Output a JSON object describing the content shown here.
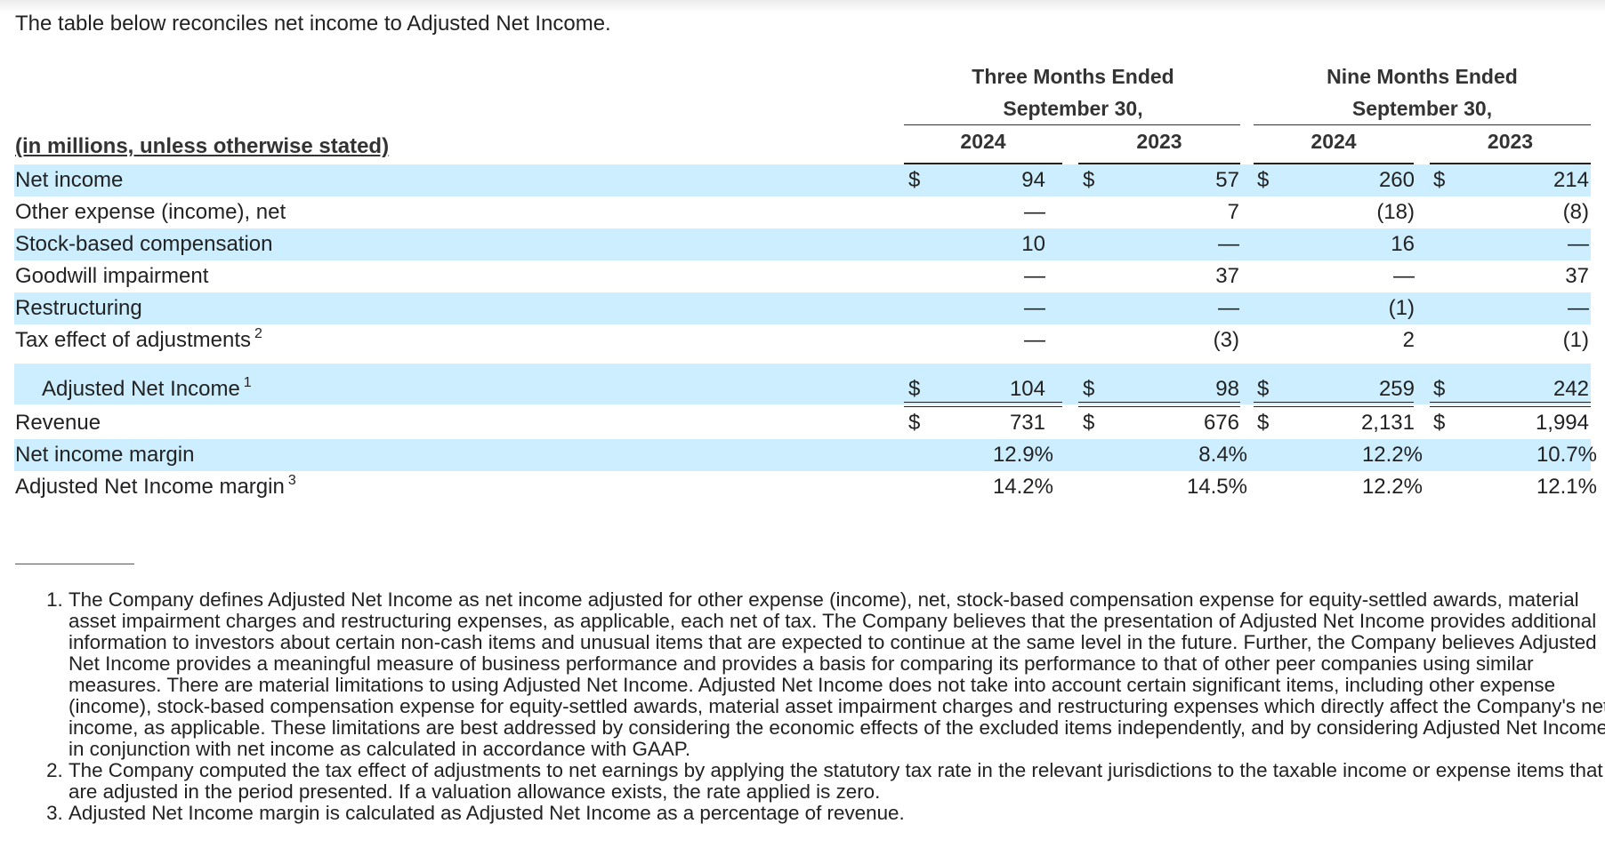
{
  "intro": "The table below reconciles net income to Adjusted Net Income.",
  "header": {
    "units_label": "(in millions, unless otherwise stated)",
    "groups": [
      {
        "line1": "Three Months Ended",
        "line2": "September 30,",
        "years": [
          "2024",
          "2023"
        ]
      },
      {
        "line1": "Nine Months Ended",
        "line2": "September 30,",
        "years": [
          "2024",
          "2023"
        ]
      }
    ]
  },
  "currency_symbol": "$",
  "rows": [
    {
      "label": "Net income",
      "sup": "",
      "values": [
        "94",
        "57",
        "260",
        "214"
      ]
    },
    {
      "label": "Other expense (income), net",
      "sup": "",
      "values": [
        "—",
        "7",
        "(18)",
        "(8)"
      ]
    },
    {
      "label": "Stock-based compensation",
      "sup": "",
      "values": [
        "10",
        "—",
        "16",
        "—"
      ]
    },
    {
      "label": "Goodwill impairment",
      "sup": "",
      "values": [
        "—",
        "37",
        "—",
        "37"
      ]
    },
    {
      "label": "Restructuring",
      "sup": "",
      "values": [
        "—",
        "—",
        "(1)",
        "—"
      ]
    },
    {
      "label": "Tax effect of adjustments",
      "sup": "2",
      "values": [
        "—",
        "(3)",
        "2",
        "(1)"
      ]
    },
    {
      "label": "Adjusted Net Income",
      "sup": "1",
      "values": [
        "104",
        "98",
        "259",
        "242"
      ]
    },
    {
      "label": "Revenue",
      "sup": "",
      "values": [
        "731",
        "676",
        "2,131",
        "1,994"
      ]
    },
    {
      "label": "Net income margin",
      "sup": "",
      "values": [
        "12.9%",
        "8.4%",
        "12.2%",
        "10.7%"
      ]
    },
    {
      "label": "Adjusted Net Income margin",
      "sup": "3",
      "values": [
        "14.2%",
        "14.5%",
        "12.2%",
        "12.1%"
      ]
    }
  ],
  "footnotes": [
    "The Company defines Adjusted Net Income as net income adjusted for other expense (income), net, stock-based compensation expense for equity-settled awards, material asset impairment charges and restructuring expenses, as applicable, each net of tax. The Company believes that the presentation of Adjusted Net Income provides additional information to investors about certain non-cash items and unusual items that are expected to continue at the same level in the future. Further, the Company believes Adjusted Net Income provides a meaningful measure of business performance and provides a basis for comparing its performance to that of other peer companies using similar measures. There are material limitations to using Adjusted Net Income. Adjusted Net Income does not take into account certain significant items, including other expense (income), stock-based compensation expense for equity-settled awards, material asset impairment charges and restructuring expenses which directly affect the Company's net income, as applicable. These limitations are best addressed by considering the economic effects of the excluded items independently, and by considering Adjusted Net Income in conjunction with net income as calculated in accordance with GAAP.",
    "The Company computed the tax effect of adjustments to net earnings by applying the statutory tax rate in the relevant jurisdictions to the taxable income or expense items that are adjusted in the period presented. If a valuation allowance exists, the rate applied is zero.",
    "Adjusted Net Income margin is calculated as Adjusted Net Income as a percentage of revenue."
  ]
}
